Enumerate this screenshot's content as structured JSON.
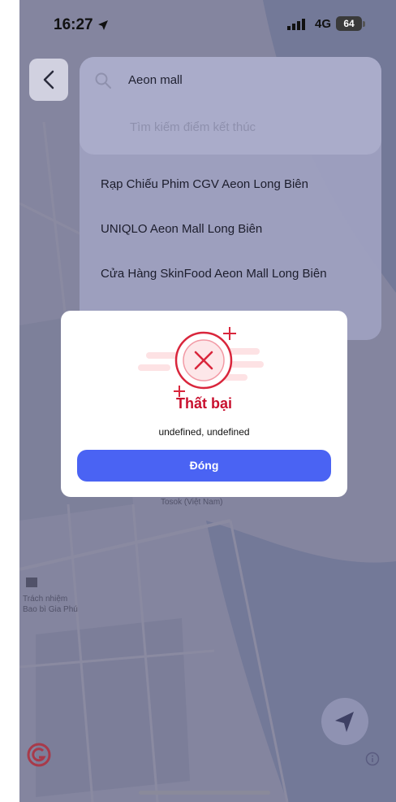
{
  "status_bar": {
    "time": "16:27",
    "network": "4G",
    "battery": "64"
  },
  "search": {
    "query": "Aeon mall",
    "end_placeholder": "Tìm kiếm điểm kết thúc"
  },
  "results": [
    {
      "label": "Rạp Chiếu Phim CGV Aeon Long Biên"
    },
    {
      "label": "UNIQLO Aeon Mall Long Biên"
    },
    {
      "label": "Cửa Hàng SkinFood Aeon Mall Long Biên"
    }
  ],
  "dialog": {
    "title": "Thất bại",
    "message": "undefined, undefined",
    "close_label": "Đóng"
  },
  "map": {
    "label_1": "Tosok (Việt Nam)",
    "label_2": "Trách nhiệm",
    "label_3": "Bao bì Gia Phú"
  },
  "colors": {
    "accent": "#4a63f3",
    "error": "#c8102e",
    "overlay": "#48486e"
  }
}
